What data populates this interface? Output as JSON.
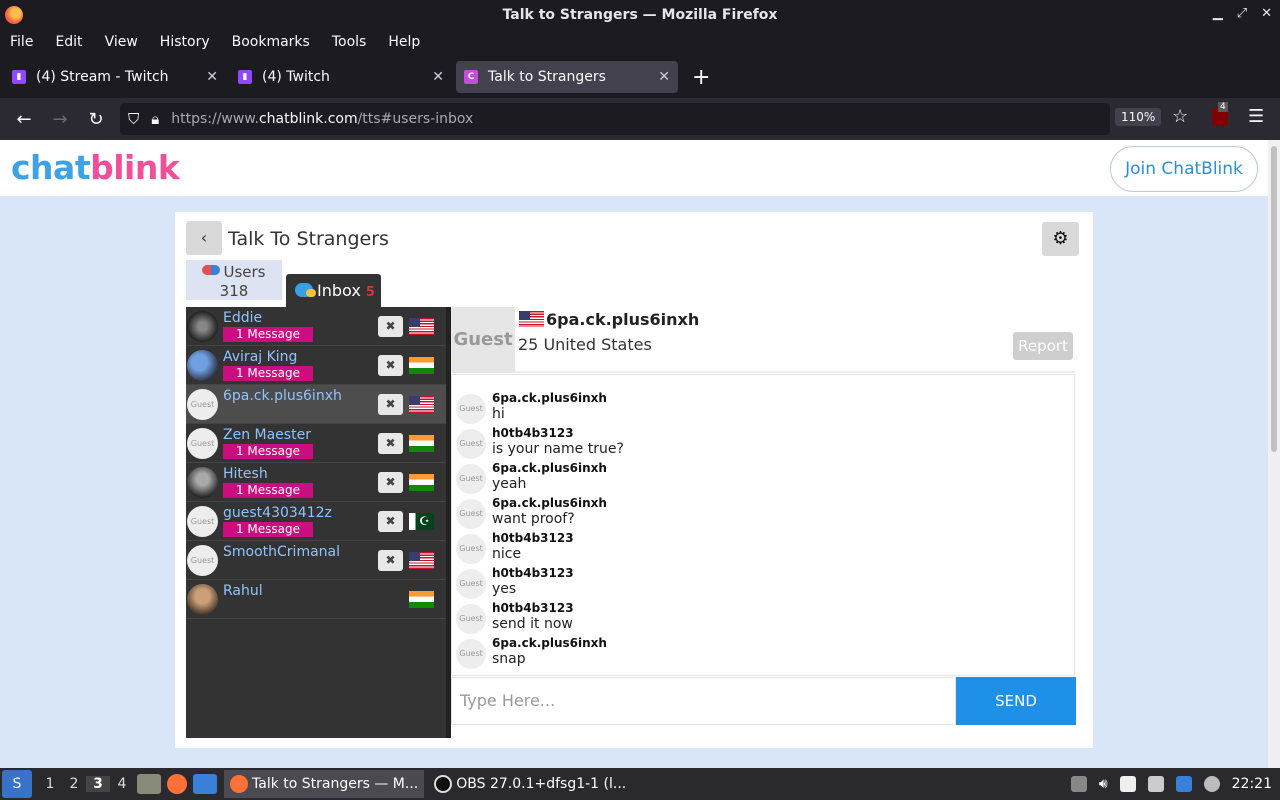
{
  "window": {
    "title": "Talk to Strangers — Mozilla Firefox"
  },
  "menu": [
    "File",
    "Edit",
    "View",
    "History",
    "Bookmarks",
    "Tools",
    "Help"
  ],
  "tabs": [
    {
      "label": "(4) Stream - Twitch",
      "icon": "twitch-icon"
    },
    {
      "label": "(4) Twitch",
      "icon": "twitch-icon"
    },
    {
      "label": "Talk to Strangers",
      "icon": "chatblink-icon",
      "active": true
    }
  ],
  "nav": {
    "url_prefix": "https://www.",
    "url_domain": "chatblink.com",
    "url_path": "/tts#users-inbox",
    "zoom": "110%",
    "ext_badge": "4"
  },
  "site": {
    "logo_part1": "chat",
    "logo_part2": "blink",
    "join_label": "Join ChatBlink"
  },
  "card": {
    "title": "Talk To Strangers",
    "users_tab_label": "Users",
    "users_count": "318",
    "inbox_tab_label": "Inbox",
    "inbox_count": "5"
  },
  "users": [
    {
      "name": "Eddie",
      "badge": "1 Message",
      "flag": "us",
      "avatar": "photo1"
    },
    {
      "name": "Aviraj King",
      "badge": "1 Message",
      "flag": "in",
      "avatar": "photo2"
    },
    {
      "name": "6pa.ck.plus6inxh",
      "badge": "",
      "flag": "us",
      "avatar": "guest",
      "selected": true
    },
    {
      "name": "Zen Maester",
      "badge": "1 Message",
      "flag": "in",
      "avatar": "guest"
    },
    {
      "name": "Hitesh",
      "badge": "1 Message",
      "flag": "in",
      "avatar": "photo3"
    },
    {
      "name": "guest4303412z",
      "badge": "1 Message",
      "flag": "pk",
      "avatar": "guest"
    },
    {
      "name": "SmoothCrimanal",
      "badge": "",
      "flag": "us",
      "avatar": "guest"
    },
    {
      "name": "Rahul",
      "badge": "",
      "flag": "in",
      "avatar": "photo4",
      "no_close": true
    }
  ],
  "guest_label": "Guest",
  "chat": {
    "name": "6pa.ck.plus6inxh",
    "info": "25 United States",
    "report_label": "Report",
    "messages": [
      {
        "from": "6pa.ck.plus6inxh",
        "text": "hi"
      },
      {
        "from": "h0tb4b3123",
        "text": "is your name true?"
      },
      {
        "from": "6pa.ck.plus6inxh",
        "text": "yeah"
      },
      {
        "from": "6pa.ck.plus6inxh",
        "text": "want proof?"
      },
      {
        "from": "h0tb4b3123",
        "text": "nice"
      },
      {
        "from": "h0tb4b3123",
        "text": "yes"
      },
      {
        "from": "h0tb4b3123",
        "text": "send it now"
      },
      {
        "from": "6pa.ck.plus6inxh",
        "text": "snap"
      }
    ],
    "input_placeholder": "Type Here...",
    "send_label": "SEND"
  },
  "taskbar": {
    "workspaces": [
      "1",
      "2",
      "3",
      "4"
    ],
    "current_workspace": "3",
    "tasks": [
      {
        "label": "Talk to Strangers — M...",
        "active": true
      },
      {
        "label": "OBS 27.0.1+dfsg1-1 (l...",
        "active": false
      }
    ],
    "clock": "22:21"
  }
}
